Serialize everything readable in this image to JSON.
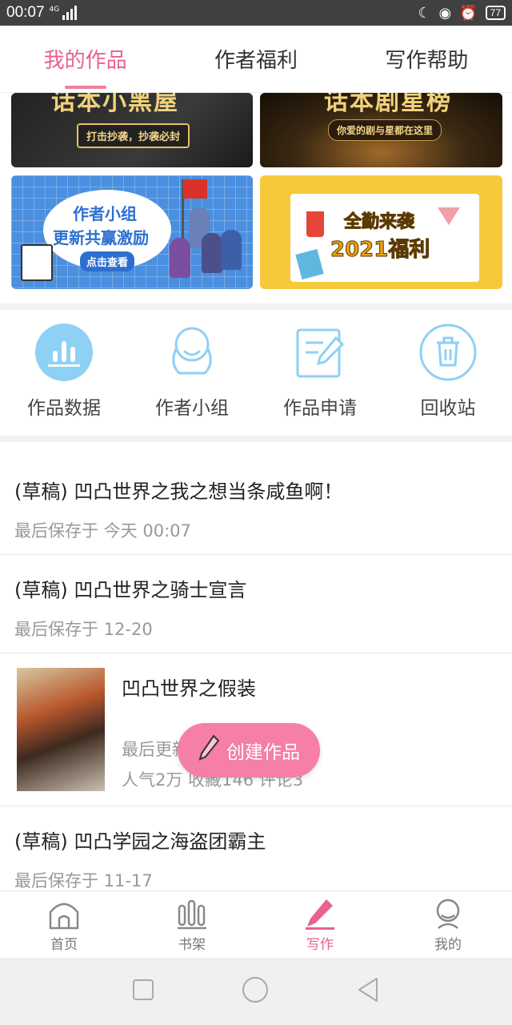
{
  "status_bar": {
    "time": "00:07",
    "network": "4G",
    "battery": "77"
  },
  "top_tabs": [
    {
      "label": "我的作品",
      "active": true
    },
    {
      "label": "作者福利",
      "active": false
    },
    {
      "label": "写作帮助",
      "active": false
    }
  ],
  "banners": [
    {
      "title": "话本小黑屋",
      "subtitle": "打击抄袭，抄袭必封"
    },
    {
      "title": "话本剧星榜",
      "subtitle": "你爱的剧与星都在这里"
    },
    {
      "line1": "作者小组",
      "line2": "更新共赢激励",
      "cta": "点击查看"
    },
    {
      "line1": "全勤来袭",
      "line2": "2021福利"
    }
  ],
  "shortcuts": [
    {
      "label": "作品数据",
      "icon": "bar-chart-icon"
    },
    {
      "label": "作者小组",
      "icon": "group-avatar-icon"
    },
    {
      "label": "作品申请",
      "icon": "edit-document-icon"
    },
    {
      "label": "回收站",
      "icon": "trash-icon"
    }
  ],
  "works": [
    {
      "title": "(草稿) 凹凸世界之我之想当条咸鱼啊！",
      "meta": "最后保存于 今天 00:07"
    },
    {
      "title": "(草稿) 凹凸世界之骑士宣言",
      "meta": "最后保存于 12-20"
    },
    {
      "title": "凹凸世界之假装",
      "meta": "最后更新",
      "stats": "人气2万  收藏146  评论3"
    },
    {
      "title": "(草稿) 凹凸学园之海盗团霸主",
      "meta": "最后保存于 11-17"
    }
  ],
  "fab": {
    "label": "创建作品"
  },
  "bottom_nav": [
    {
      "label": "首页",
      "icon": "home-icon",
      "active": false
    },
    {
      "label": "书架",
      "icon": "bookshelf-icon",
      "active": false
    },
    {
      "label": "写作",
      "icon": "pen-icon",
      "active": true
    },
    {
      "label": "我的",
      "icon": "profile-icon",
      "active": false
    }
  ],
  "colors": {
    "accent": "#e8628c",
    "fab": "#f57fa6",
    "icon_blue": "#8fd0f5"
  }
}
